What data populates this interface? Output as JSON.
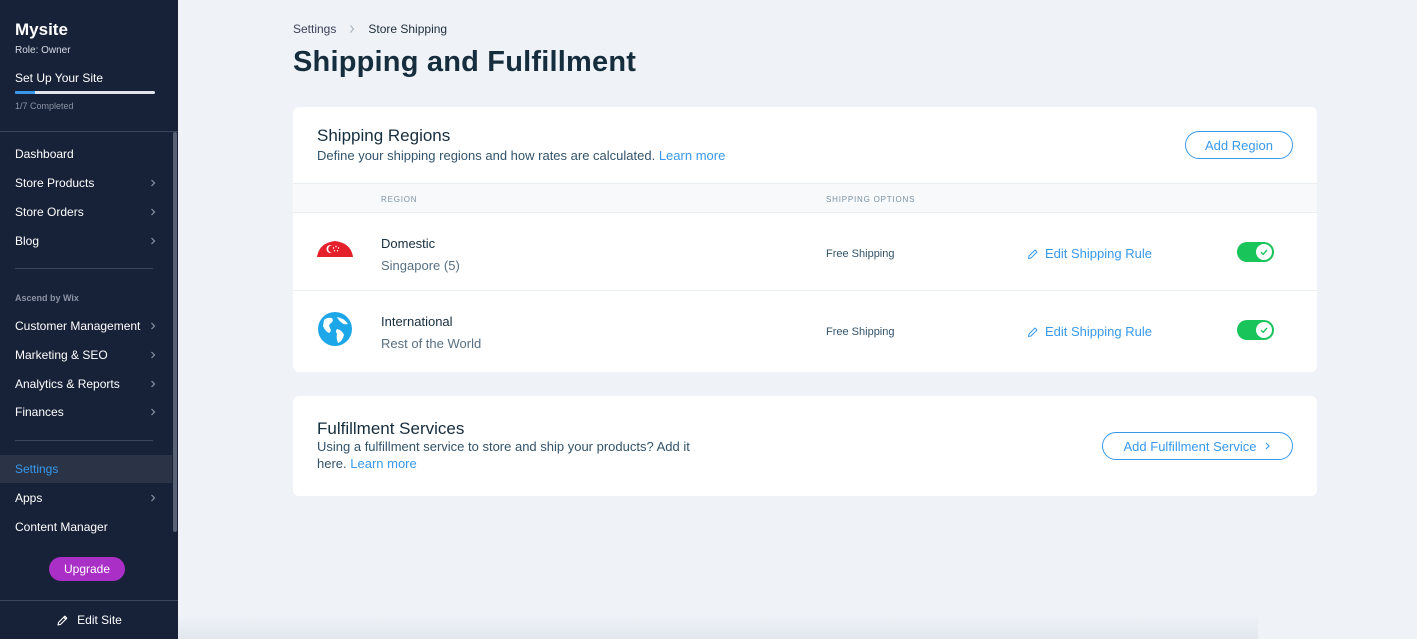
{
  "sidebar": {
    "site_name": "Mysite",
    "role": "Role: Owner",
    "setup_label": "Set Up Your Site",
    "setup_progress": 0.143,
    "progress_text": "1/7 Completed",
    "section_label": "Ascend by Wix",
    "items": [
      {
        "label": "Dashboard"
      },
      {
        "label": "Store Products"
      },
      {
        "label": "Store Orders"
      },
      {
        "label": "Blog"
      },
      {
        "label": "Customer Management"
      },
      {
        "label": "Marketing & SEO"
      },
      {
        "label": "Analytics & Reports"
      },
      {
        "label": "Finances"
      },
      {
        "label": "Settings"
      },
      {
        "label": "Apps"
      },
      {
        "label": "Content Manager"
      }
    ],
    "upgrade_label": "Upgrade",
    "edit_site_label": "Edit Site",
    "accent_color": "#3899ec",
    "upgrade_color": "#aa2fc6"
  },
  "breadcrumb": {
    "parent": "Settings",
    "current": "Store Shipping"
  },
  "page_title": "Shipping and Fulfillment",
  "shipping_regions": {
    "title": "Shipping Regions",
    "subtitle": "Define your shipping regions and how rates are calculated.",
    "learn_more": "Learn more",
    "add_button": "Add Region",
    "columns": {
      "region": "REGION",
      "shipping_options": "SHIPPING OPTIONS"
    },
    "rows": [
      {
        "icon": "singapore-flag-icon",
        "name": "Domestic",
        "detail": "Singapore (5)",
        "shipping_option": "Free Shipping",
        "edit_label": "Edit Shipping Rule",
        "enabled": true
      },
      {
        "icon": "globe-icon",
        "name": "International",
        "detail": "Rest of the World",
        "shipping_option": "Free Shipping",
        "edit_label": "Edit Shipping Rule",
        "enabled": true
      }
    ]
  },
  "fulfillment": {
    "title": "Fulfillment Services",
    "subtitle_line1": "Using a fulfillment service to store and ship your products? Add it",
    "subtitle_line2": "here.",
    "learn_more": "Learn more",
    "add_button": "Add Fulfillment Service"
  },
  "colors": {
    "toggle_on": "#19c45b",
    "link": "#3899ec"
  }
}
